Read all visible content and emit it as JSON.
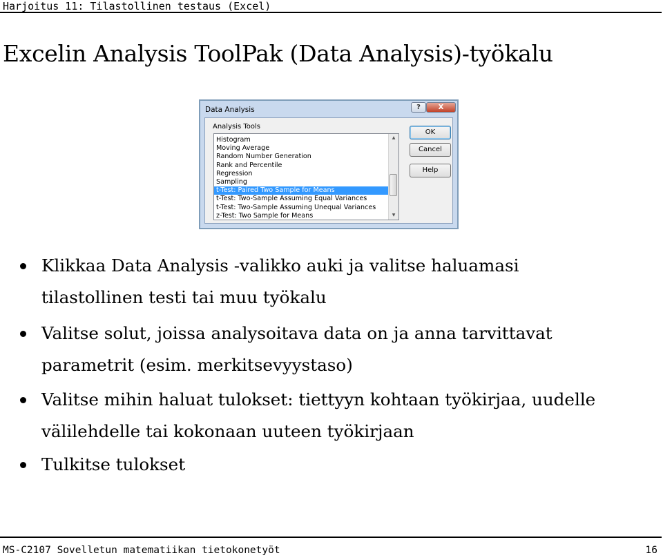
{
  "header": {
    "course_title": "Harjoitus 11: Tilastollinen testaus (Excel)"
  },
  "slide": {
    "title": "Excelin Analysis ToolPak (Data Analysis)-työkalu"
  },
  "dialog": {
    "title": "Data Analysis",
    "help_icon": "?",
    "close_icon": "X",
    "tools_label": "Analysis Tools",
    "tools": [
      "Histogram",
      "Moving Average",
      "Random Number Generation",
      "Rank and Percentile",
      "Regression",
      "Sampling",
      "t-Test: Paired Two Sample for Means",
      "t-Test: Two-Sample Assuming Equal Variances",
      "t-Test: Two-Sample Assuming Unequal Variances",
      "z-Test: Two Sample for Means"
    ],
    "selected_tool": "t-Test: Paired Two Sample for Means",
    "buttons": {
      "ok": "OK",
      "cancel": "Cancel",
      "help": "Help"
    }
  },
  "bullets": [
    "Klikkaa Data Analysis -valikko auki ja valitse haluamasi\ntilastollinen testi tai muu työkalu",
    "Valitse solut, joissa analysoitava data on ja anna tarvittavat\nparametrit (esim. merkitsevyystaso)",
    "Valitse mihin haluat tulokset: tiettyyn kohtaan työkirjaa, uudelle\nvälilehdelle tai kokonaan uuteen työkirjaan",
    "Tulkitse tulokset"
  ],
  "footer": {
    "course": "MS-C2107 Sovelletun matematiikan tietokonetyöt",
    "page": "16"
  }
}
